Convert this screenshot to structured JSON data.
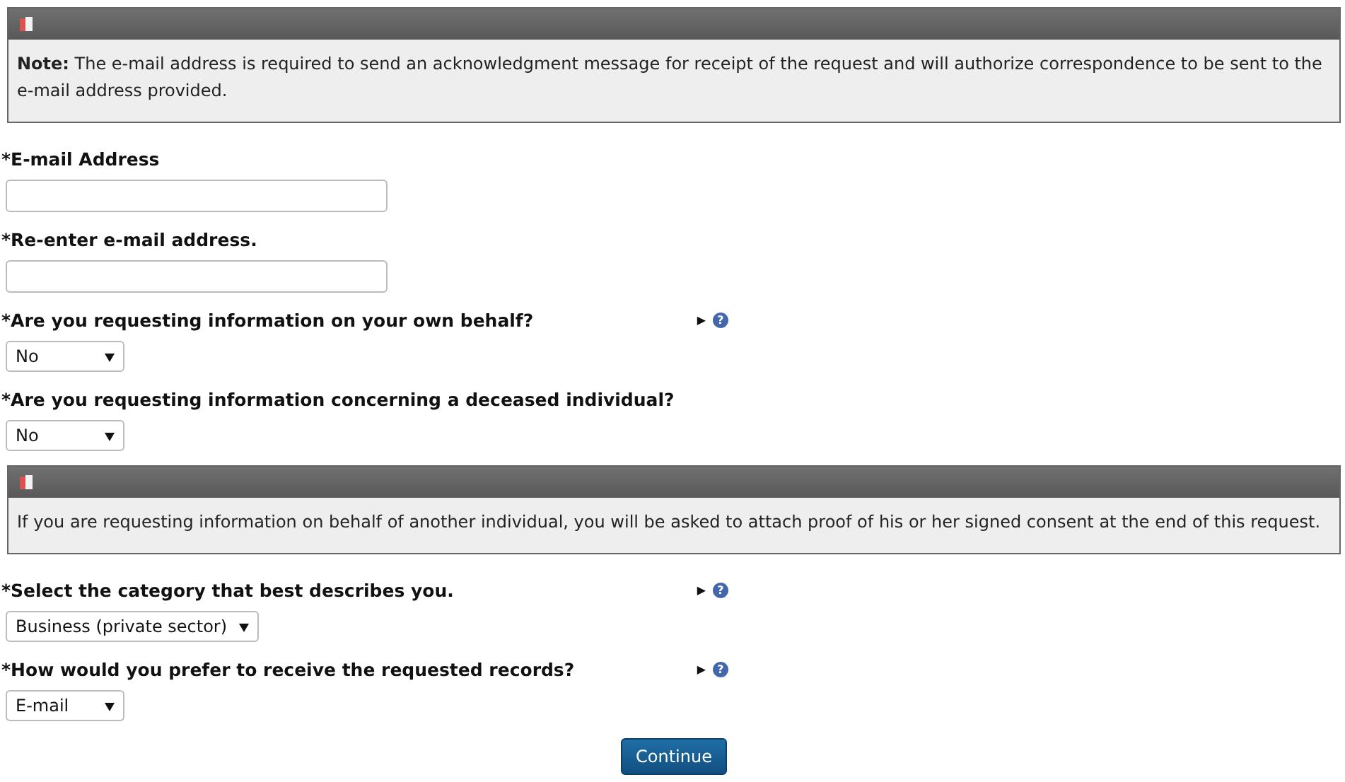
{
  "items": [
    {
      "kind": "notice",
      "text": "**Note:** The e-mail address is required to send an acknowledgment message for receipt of the request and will authorize correspondence to be sent to the e-mail address provided."
    },
    {
      "kind": "text_field",
      "label": "*E-mail Address"
    },
    {
      "kind": "text_field",
      "label": "*Re-enter e-mail address."
    },
    {
      "kind": "select",
      "label": "*Are you requesting information on your own behalf?",
      "value": "No",
      "help": {
        "arrow": "▶",
        "icon": "?"
      }
    },
    {
      "kind": "select",
      "label": "*Are you requesting information concerning a deceased individual?",
      "value": "No"
    },
    {
      "kind": "notice",
      "text": "If you are requesting information on behalf of another individual, you will be asked to attach proof of his or her signed consent at the end of this request."
    },
    {
      "kind": "select",
      "label": "*Select the category that best describes you.",
      "value": "Business (private sector)",
      "help": {
        "arrow": "▶",
        "icon": "?"
      }
    },
    {
      "kind": "select",
      "label": "*How would you prefer to receive the requested records?",
      "value": "E-mail",
      "help": {
        "arrow": "▶",
        "icon": "?"
      }
    }
  ],
  "continue_button": "Continue"
}
